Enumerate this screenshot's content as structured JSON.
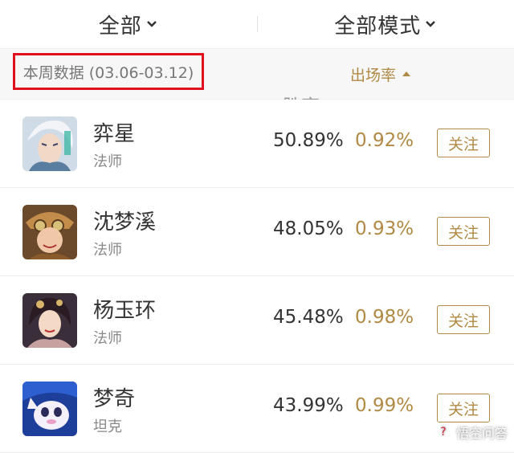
{
  "header": {
    "filter_all": "全部",
    "filter_mode": "全部模式"
  },
  "subbar": {
    "week_label": "本周数据 (03.06-03.12)",
    "sort_win_rate": "胜率",
    "sort_appearance_rate": "出场率"
  },
  "heroes": [
    {
      "name": "弈星",
      "role": "法师",
      "win_rate": "50.89%",
      "appearance_rate": "0.92%",
      "follow_label": "关注"
    },
    {
      "name": "沈梦溪",
      "role": "法师",
      "win_rate": "48.05%",
      "appearance_rate": "0.93%",
      "follow_label": "关注"
    },
    {
      "name": "杨玉环",
      "role": "法师",
      "win_rate": "45.48%",
      "appearance_rate": "0.98%",
      "follow_label": "关注"
    },
    {
      "name": "梦奇",
      "role": "坦克",
      "win_rate": "43.99%",
      "appearance_rate": "0.99%",
      "follow_label": "关注"
    }
  ],
  "watermark": "悟空问答",
  "colors": {
    "accent": "#b08a45",
    "highlight_box": "#e0101d"
  }
}
